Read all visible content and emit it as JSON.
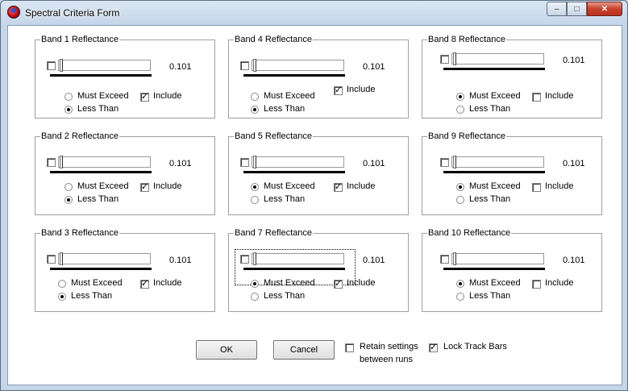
{
  "window": {
    "title": "Spectral Criteria Form",
    "buttons": {
      "minimize": "–",
      "maximize": "□",
      "close": "✕"
    }
  },
  "bands": [
    {
      "title": "Band 1 Reflectance",
      "value": "0.101",
      "must_exceed": "Must Exceed",
      "less_than": "Less Than",
      "selected": "less_than",
      "include_label": "Include",
      "include": true,
      "enabled": false,
      "slider_fraction": 0
    },
    {
      "title": "Band 4 Reflectance",
      "value": "0.101",
      "must_exceed": "Must Exceed",
      "less_than": "Less Than",
      "selected": "less_than",
      "include_label": "Include",
      "include": true,
      "enabled": false,
      "slider_fraction": 0
    },
    {
      "title": "Band 8 Reflectance",
      "value": "0.101",
      "must_exceed": "Must Exceed",
      "less_than": "Less Than",
      "selected": "must_exceed",
      "include_label": "Include",
      "include": false,
      "enabled": false,
      "slider_fraction": 0
    },
    {
      "title": "Band 2 Reflectance",
      "value": "0.101",
      "must_exceed": "Must Exceed",
      "less_than": "Less Than",
      "selected": "less_than",
      "include_label": "Include",
      "include": true,
      "enabled": false,
      "slider_fraction": 0
    },
    {
      "title": "Band 5 Reflectance",
      "value": "0.101",
      "must_exceed": "Must Exceed",
      "less_than": "Less Than",
      "selected": "must_exceed",
      "include_label": "Include",
      "include": true,
      "enabled": false,
      "slider_fraction": 0
    },
    {
      "title": "Band 9 Reflectance",
      "value": "0.101",
      "must_exceed": "Must Exceed",
      "less_than": "Less Than",
      "selected": "must_exceed",
      "include_label": "Include",
      "include": false,
      "enabled": false,
      "slider_fraction": 0
    },
    {
      "title": "Band 3 Reflectance",
      "value": "0.101",
      "must_exceed": "Must Exceed",
      "less_than": "Less Than",
      "selected": "less_than",
      "include_label": "Include",
      "include": true,
      "enabled": false,
      "slider_fraction": 0
    },
    {
      "title": "Band 7 Reflectance",
      "value": "0.101",
      "must_exceed": "Must Exceed",
      "less_than": "Less Than",
      "selected": "must_exceed",
      "include_label": "Include",
      "include": true,
      "enabled": false,
      "slider_fraction": 0
    },
    {
      "title": "Band 10 Reflectance",
      "value": "0.101",
      "must_exceed": "Must Exceed",
      "less_than": "Less Than",
      "selected": "must_exceed",
      "include_label": "Include",
      "include": false,
      "enabled": false,
      "slider_fraction": 0
    }
  ],
  "footer": {
    "ok": "OK",
    "cancel": "Cancel",
    "retain_line1": "Retain settings",
    "retain_line2": "between runs",
    "retain_checked": false,
    "lock_label": "Lock Track Bars",
    "lock_checked": true
  }
}
